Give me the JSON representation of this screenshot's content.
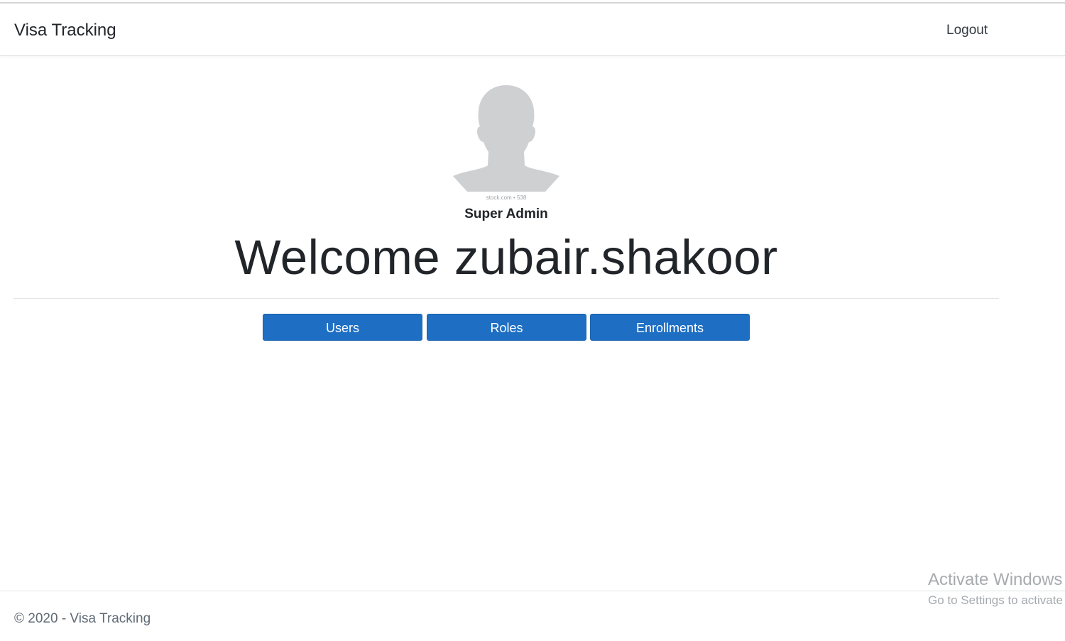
{
  "navbar": {
    "brand": "Visa Tracking",
    "logout": "Logout"
  },
  "profile": {
    "role": "Super Admin",
    "welcome": "Welcome zubair.shakoor",
    "avatar_caption": "stock.com • 538"
  },
  "actions": {
    "users": "Users",
    "roles": "Roles",
    "enrollments": "Enrollments"
  },
  "footer": {
    "text": "© 2020 - Visa Tracking"
  },
  "os_watermark": {
    "title": "Activate Windows",
    "subtitle": "Go to Settings to activate Windows."
  },
  "colors": {
    "button": "#1e6fc4",
    "avatar": "#cfd0d2"
  }
}
